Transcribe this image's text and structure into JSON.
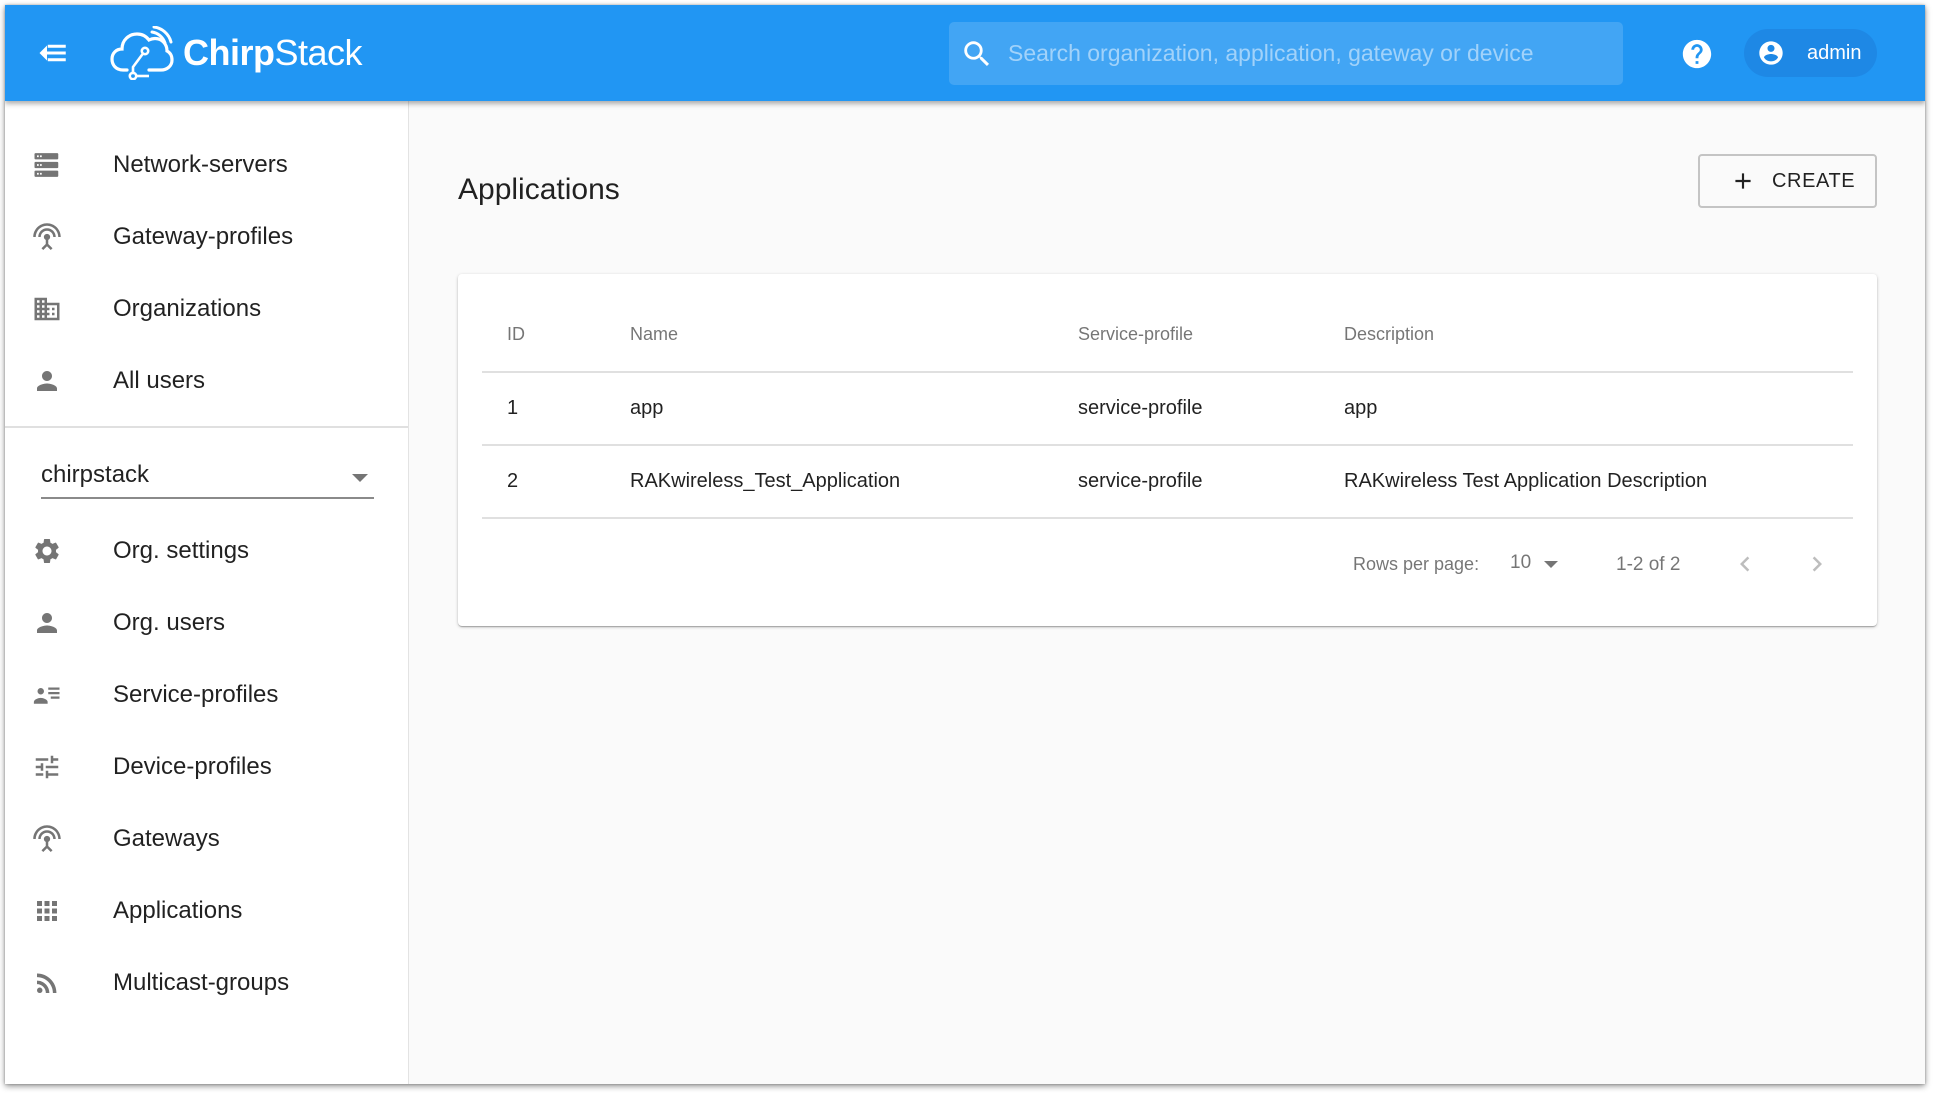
{
  "header": {
    "brand_bold": "Chirp",
    "brand_light": "Stack",
    "search_placeholder": "Search organization, application, gateway or device",
    "user": "admin",
    "color": "#2196F3"
  },
  "sidebar": {
    "global_items": [
      {
        "label": "Network-servers",
        "icon": "server-icon"
      },
      {
        "label": "Gateway-profiles",
        "icon": "antenna-icon"
      },
      {
        "label": "Organizations",
        "icon": "building-icon"
      },
      {
        "label": "All users",
        "icon": "person-icon"
      }
    ],
    "org_selector": {
      "value": "chirpstack"
    },
    "org_items": [
      {
        "label": "Org. settings",
        "icon": "gear-icon"
      },
      {
        "label": "Org. users",
        "icon": "person-icon"
      },
      {
        "label": "Service-profiles",
        "icon": "contact-list-icon"
      },
      {
        "label": "Device-profiles",
        "icon": "tune-icon"
      },
      {
        "label": "Gateways",
        "icon": "antenna-icon"
      },
      {
        "label": "Applications",
        "icon": "apps-grid-icon"
      },
      {
        "label": "Multicast-groups",
        "icon": "rss-feed-icon"
      }
    ]
  },
  "main": {
    "title": "Applications",
    "create_label": "CREATE",
    "table": {
      "columns": [
        "ID",
        "Name",
        "Service-profile",
        "Description"
      ],
      "rows": [
        {
          "id": "1",
          "name": "app",
          "service_profile": "service-profile",
          "description": "app"
        },
        {
          "id": "2",
          "name": "RAKwireless_Test_Application",
          "service_profile": "service-profile",
          "description": "RAKwireless Test Application Description"
        }
      ]
    },
    "pagination": {
      "rows_per_page_label": "Rows per page:",
      "rows_per_page": "10",
      "range": "1-2 of 2"
    },
    "link_color": "#2196F3"
  }
}
